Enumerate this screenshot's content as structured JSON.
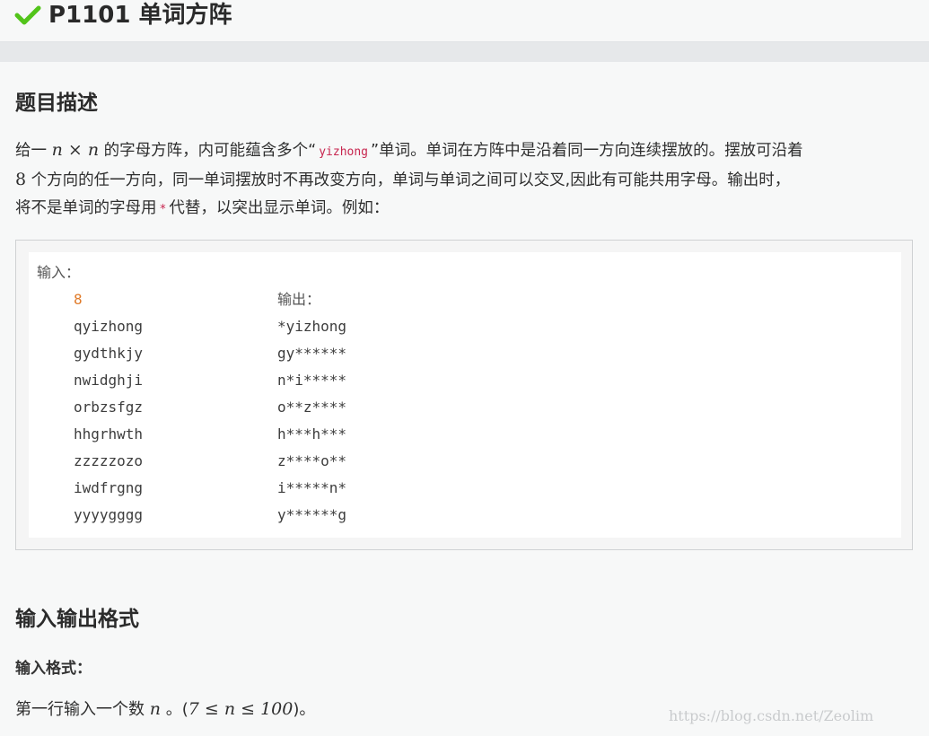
{
  "header": {
    "problem_id": "P1101",
    "title": "单词方阵",
    "status_color": "#52c41a",
    "status_icon": "check-icon"
  },
  "description": {
    "heading": "题目描述",
    "p1_a": "给一",
    "p1_math": "n × n",
    "p1_b": "的字母方阵，内可能蕴含多个“",
    "p1_code": "yizhong",
    "p1_c": "”单词。单词在方阵中是沿着同一方向连续摆放的。摆放可沿着",
    "p2_num": "8",
    "p2_text": "个方向的任一方向，同一单词摆放时不再改变方向，单词与单词之间可以交叉,因此有可能共用字母。输出时，",
    "p3_a": "将不是单词的字母用",
    "p3_code": "*",
    "p3_b": "代替，以突出显示单词。例如："
  },
  "example": {
    "input_label": "输入：",
    "output_label": "输出：",
    "n": "8",
    "input_rows": [
      "qyizhong",
      "gydthkjy",
      "nwidghji",
      "orbzsfgz",
      "hhgrhwth",
      "zzzzzozo",
      "iwdfrgng",
      "yyyygggg"
    ],
    "output_rows": [
      "*yizhong",
      "gy******",
      "n*i*****",
      "o**z****",
      "h***h***",
      "z****o**",
      "i*****n*",
      "y******g"
    ]
  },
  "io_format": {
    "heading": "输入输出格式",
    "input_heading": "输入格式：",
    "line_a": "第一行输入一个数",
    "line_math": "n",
    "line_b": "。(",
    "line_constraint": "7 ≤ n ≤ 100",
    "line_c": ")。"
  },
  "watermark": "https://blog.csdn.net/Zeolim"
}
